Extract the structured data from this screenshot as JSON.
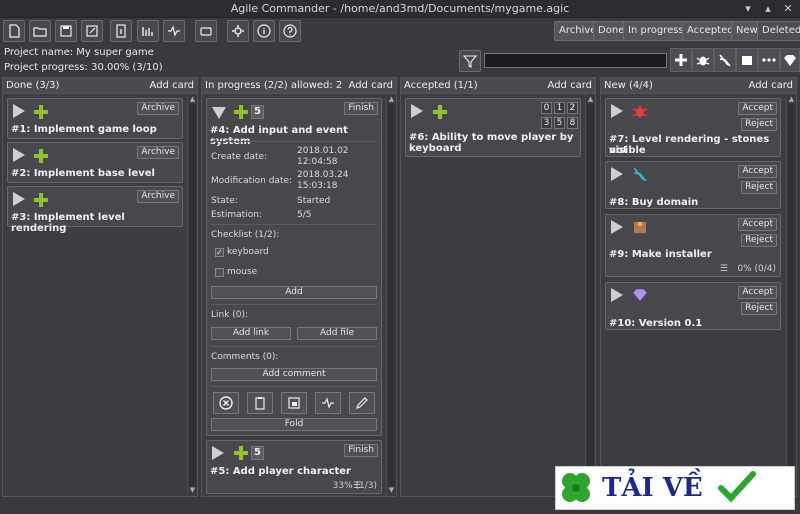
{
  "window": {
    "title": "Agile Commander - /home/and3md/Documents/mygame.agic",
    "controls": [
      "▾",
      "▴",
      "✕"
    ]
  },
  "toolbar": {
    "buttons": [
      "new-file-icon",
      "open-folder-icon",
      "save-icon",
      "save-as-icon",
      "info-icon",
      "chart-icon",
      "pulse-icon",
      "export-icon",
      "settings-icon",
      "about-icon",
      "help-icon"
    ]
  },
  "filters": [
    "Archive",
    "Done",
    "In progress",
    "Accepted",
    "New",
    "Deleted"
  ],
  "project": {
    "name_line": "Project name: My super game",
    "progress_line": "Project progress: 30.00% (3/10)"
  },
  "columns": {
    "done": {
      "title": "Done (3/3)",
      "add_label": "Add card",
      "cards": [
        {
          "title": "#1: Implement game loop",
          "action": "Archive"
        },
        {
          "title": "#2: Implement base level",
          "action": "Archive"
        },
        {
          "title": "#3: Implement level rendering",
          "action": "Archive"
        }
      ]
    },
    "inprogress": {
      "title": "In progress (2/2) allowed: 2",
      "add_label": "Add card",
      "card4": {
        "number": "5",
        "action": "Finish",
        "title": "#4: Add input and event system",
        "create_label": "Create date:",
        "create_date": "2018.01.02",
        "create_time": "12:04:58",
        "mod_label": "Modification date:",
        "mod_date": "2018.03.24",
        "mod_time": "15:03:18",
        "state_label": "State:",
        "state": "Started",
        "est_label": "Estimation:",
        "estimation": "5/5",
        "checklist_label": "Checklist (1/2):",
        "check_items": [
          {
            "label": "keyboard",
            "checked": true
          },
          {
            "label": "mouse",
            "checked": false
          }
        ],
        "add_label": "Add",
        "link_label": "Link (0):",
        "add_link": "Add link",
        "add_file": "Add file",
        "comments_label": "Comments (0):",
        "add_comment": "Add comment",
        "fold": "Fold"
      },
      "card5": {
        "number": "5",
        "action": "Finish",
        "title": "#5: Add player character",
        "progress": "33% (1/3)"
      }
    },
    "accepted": {
      "title": "Accepted (1/1)",
      "add_label": "Add card",
      "card6": {
        "title_line1": "#6: Ability to move player by",
        "title_line2": "keyboard",
        "digits_row1": [
          "0",
          "1",
          "2"
        ],
        "digits_row2": [
          "3",
          "5",
          "8"
        ]
      }
    },
    "new": {
      "title": "New (4/4)",
      "add_label": "Add card",
      "accept": "Accept",
      "reject": "Reject",
      "cards": [
        {
          "title_line1": "#7: Level rendering - stones not",
          "title_line2": "visible",
          "icon": "bug-icon"
        },
        {
          "title_line1": "#8: Buy domain",
          "title_line2": "",
          "icon": "pliers-icon"
        },
        {
          "title_line1": "#9: Make installer",
          "title_line2": "",
          "icon": "box-icon",
          "progress": "0% (0/4)"
        },
        {
          "title_line1": "#10: Version 0.1",
          "title_line2": "",
          "icon": "diamond-icon"
        }
      ]
    }
  },
  "watermark": {
    "text": "TẢI VỀ"
  },
  "colors": {
    "accent_green": "#8fc22e",
    "bug_red": "#e23b3b",
    "diamond": "#b48ef0",
    "box": "#b07a4e",
    "pliers": "#37b3d0"
  }
}
